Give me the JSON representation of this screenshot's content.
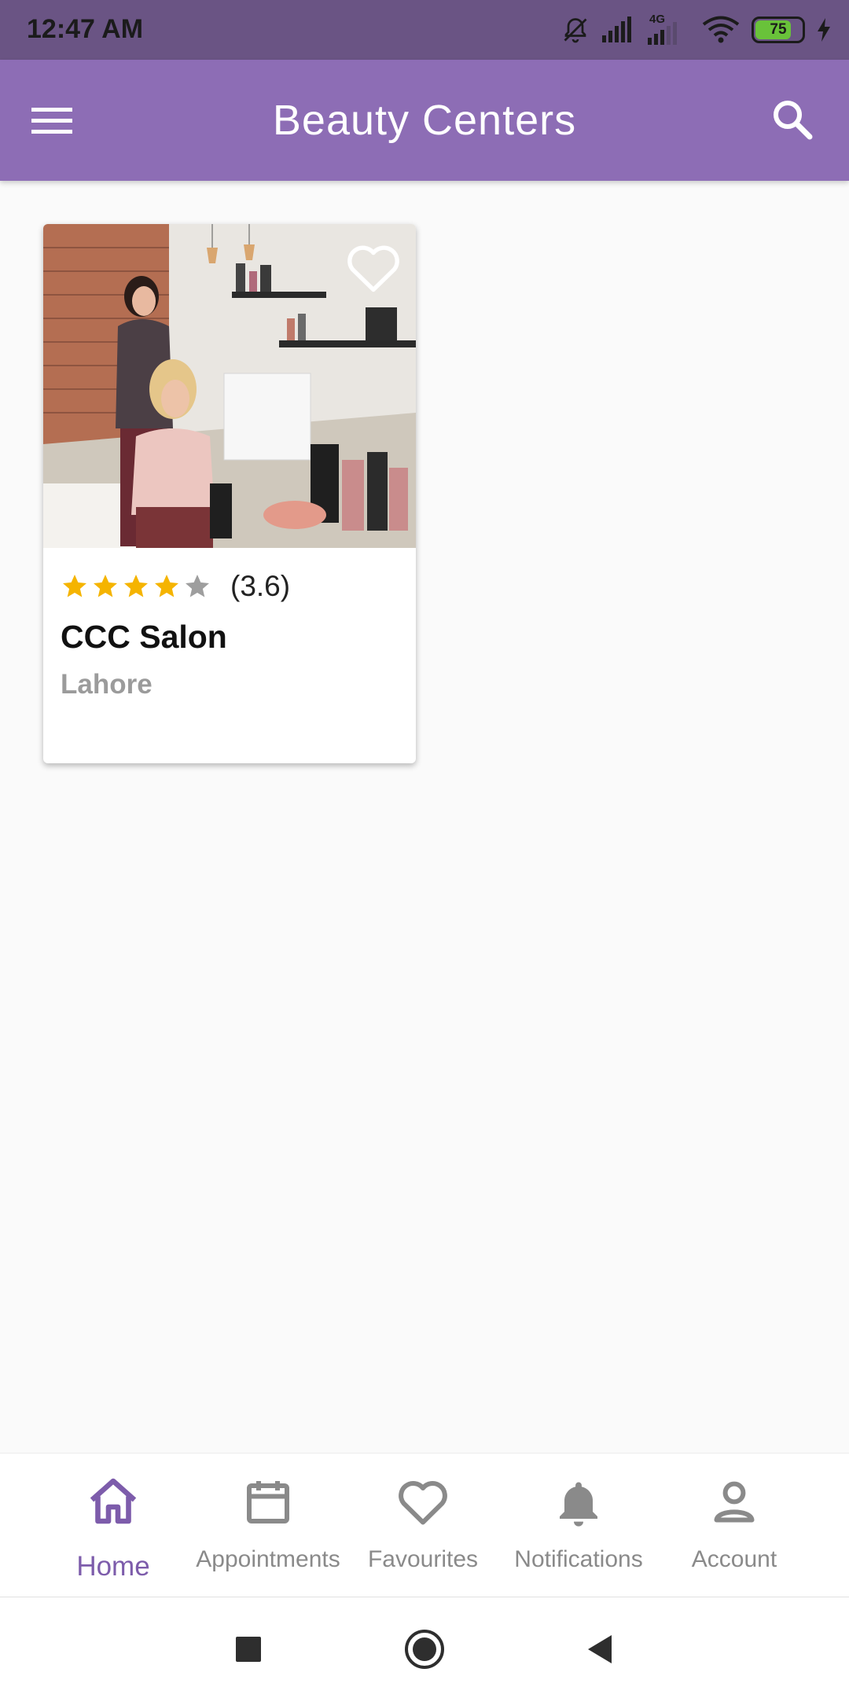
{
  "status_bar": {
    "time": "12:47 AM",
    "network": "4G",
    "battery": "75"
  },
  "app_bar": {
    "title": "Beauty Centers"
  },
  "card": {
    "rating": 3.6,
    "rating_text": "(3.6)",
    "stars_filled": 4,
    "stars_total": 5,
    "title": "CCC Salon",
    "subtitle": "Lahore"
  },
  "bottom_nav": {
    "items": [
      {
        "label": "Home",
        "icon": "home-icon",
        "active": true
      },
      {
        "label": "Appointments",
        "icon": "calendar-icon",
        "active": false
      },
      {
        "label": "Favourites",
        "icon": "heart-icon",
        "active": false
      },
      {
        "label": "Notifications",
        "icon": "bell-icon",
        "active": false
      },
      {
        "label": "Account",
        "icon": "person-icon",
        "active": false
      }
    ]
  },
  "colors": {
    "primary": "#8d6db5",
    "status_bar": "#6a5484",
    "active_nav": "#7d5cab",
    "inactive_nav": "#8a8a8a",
    "star": "#f5b400",
    "star_empty": "#9e9e9e"
  }
}
